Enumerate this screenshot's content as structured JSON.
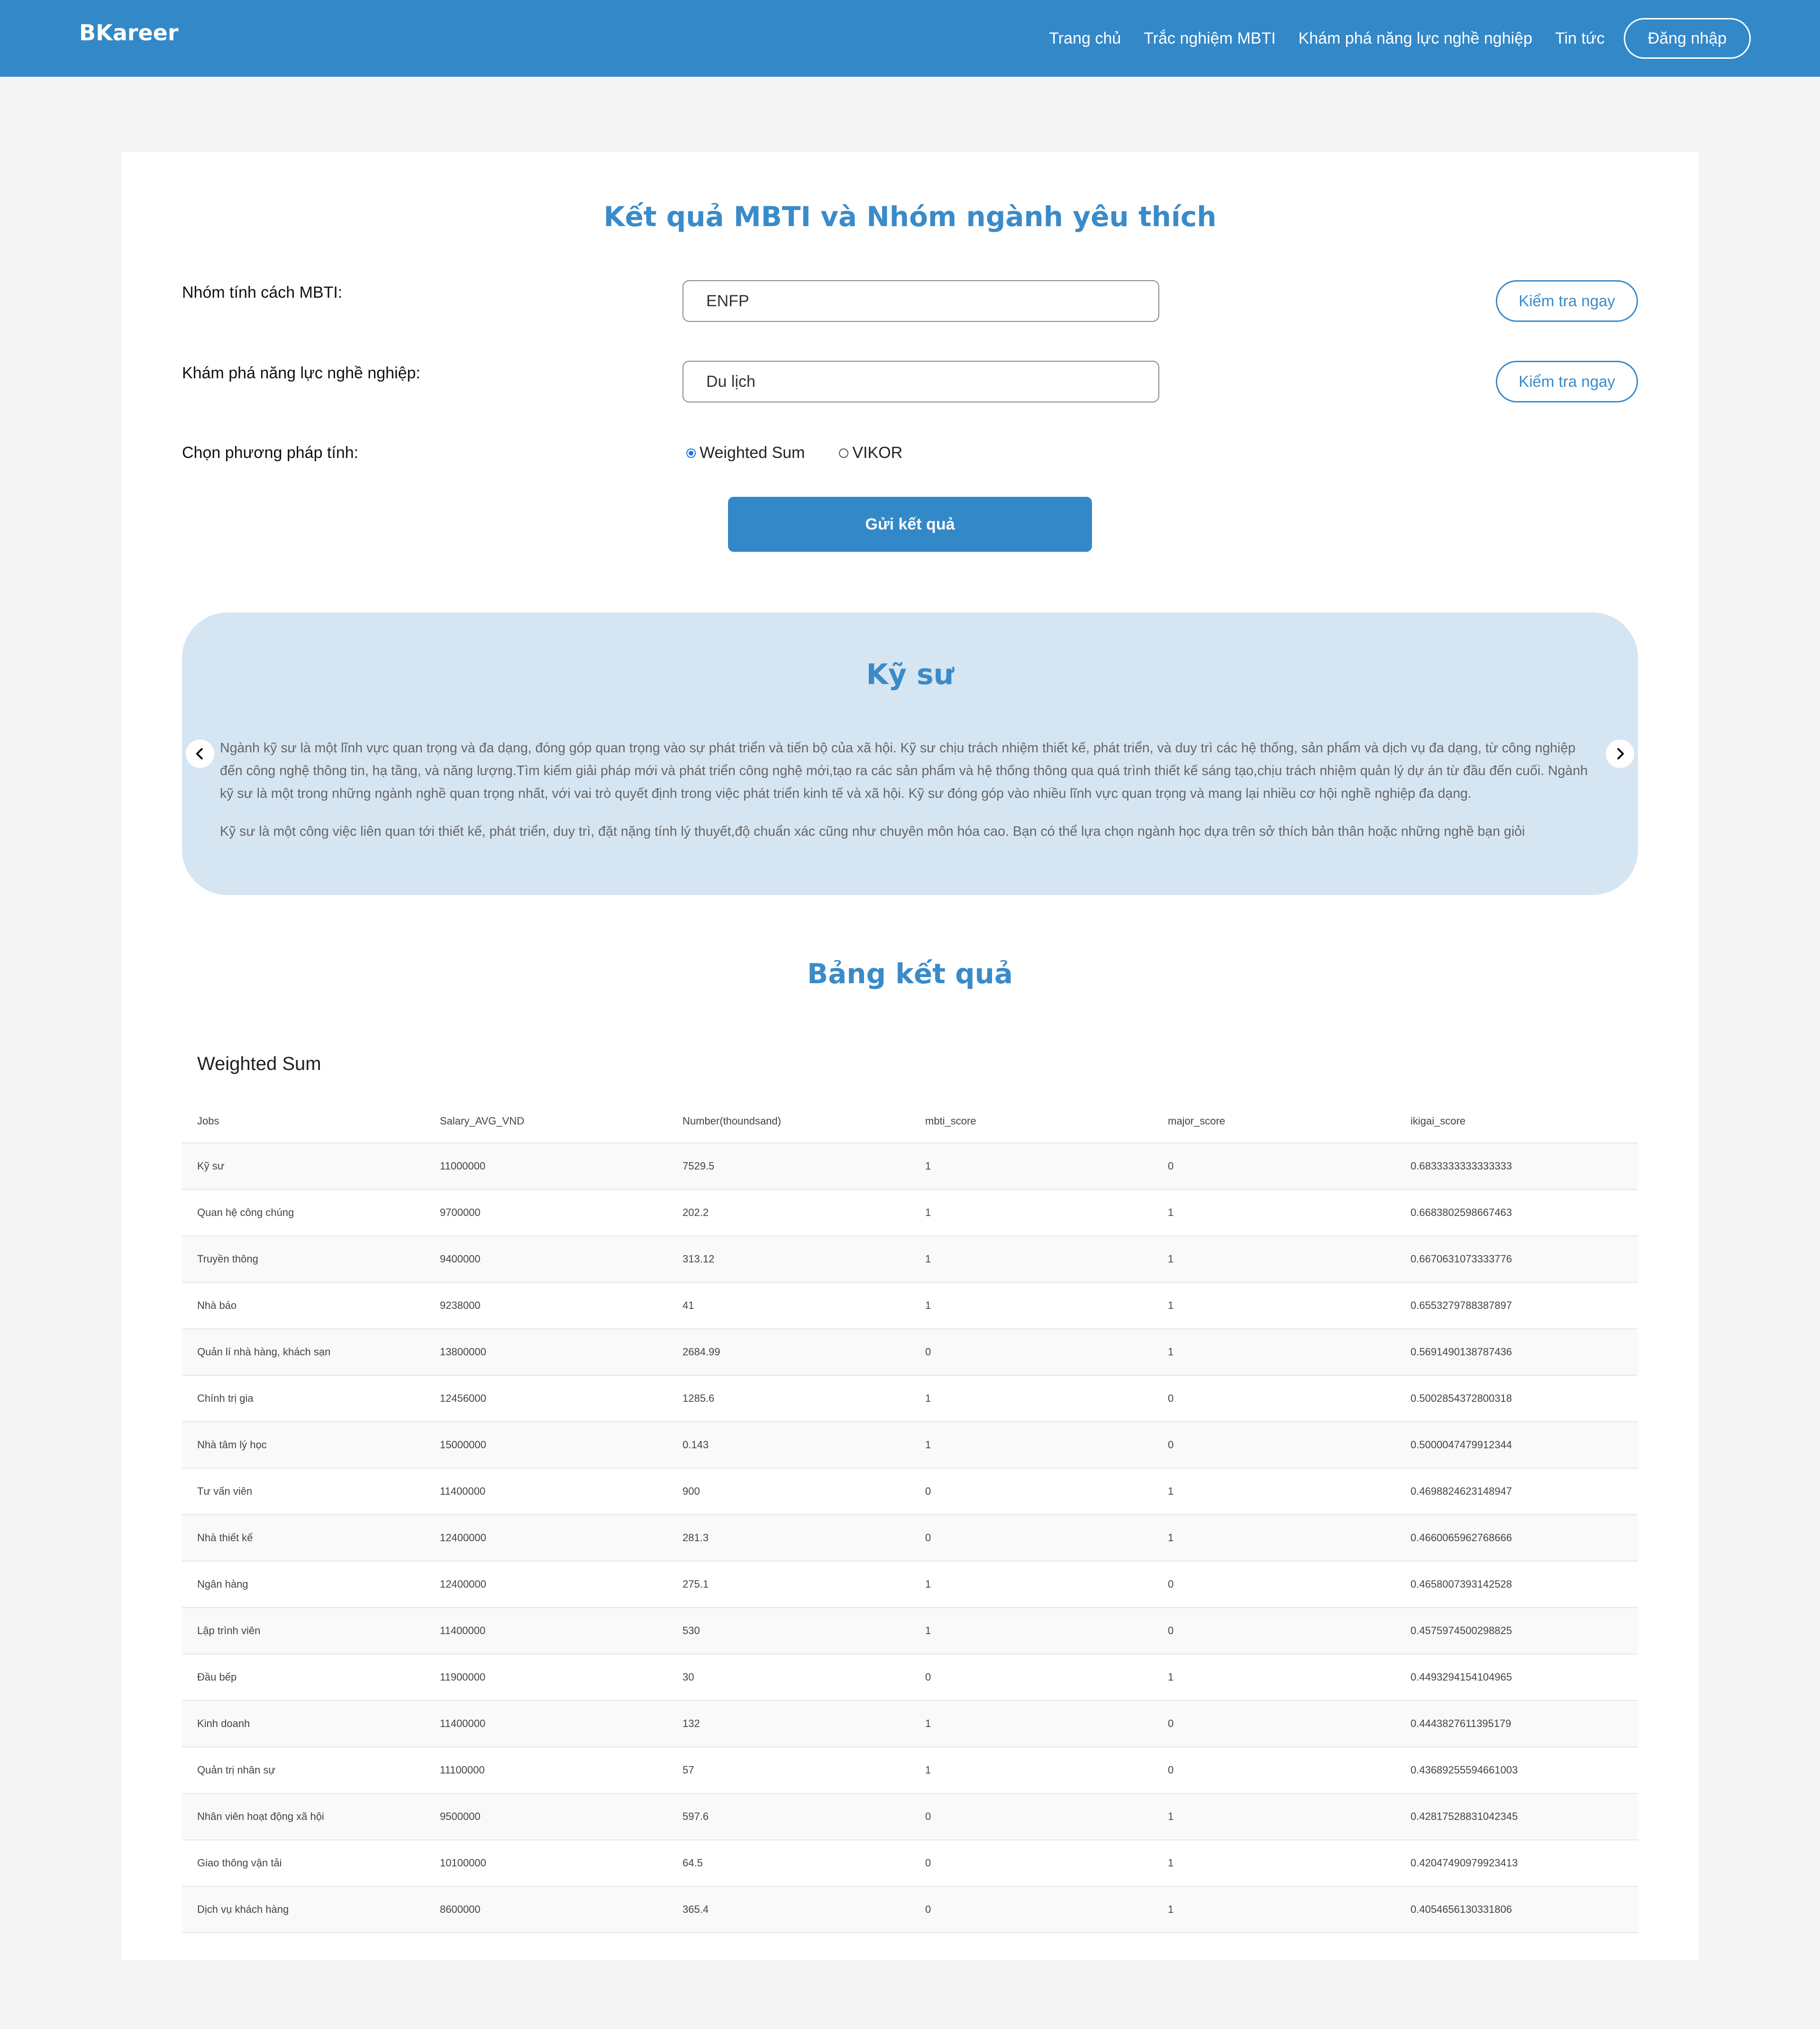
{
  "navbar": {
    "brand": "BKareer",
    "links": [
      "Trang chủ",
      "Trắc nghiệm MBTI",
      "Khám phá năng lực nghề nghiệp",
      "Tin tức"
    ],
    "login": "Đăng nhập"
  },
  "form": {
    "title": "Kết quả MBTI và Nhóm ngành yêu thích",
    "mbti_label": "Nhóm tính cách MBTI:",
    "mbti_value": "ENFP",
    "major_label": "Khám phá năng lực nghề nghiệp:",
    "major_value": "Du lịch",
    "check_label": "Kiểm tra ngay",
    "method_label": "Chọn phương pháp tính:",
    "methods": [
      "Weighted Sum",
      "VIKOR"
    ],
    "selected_method": "Weighted Sum",
    "submit_label": "Gửi kết quả"
  },
  "carousel": {
    "title": "Kỹ sư",
    "paragraph1": "Ngành kỹ sư là một lĩnh vực quan trọng và đa dạng, đóng góp quan trọng vào sự phát triển và tiến bộ của xã hội. Kỹ sư chịu trách nhiệm thiết kế, phát triển, và duy trì các hệ thống, sản phẩm và dịch vụ đa dạng, từ công nghiệp đến công nghệ thông tin, hạ tầng, và năng lượng.Tìm kiếm giải pháp mới và phát triển công nghệ mới,tạo ra các sản phẩm và hệ thống thông qua quá trình thiết kế sáng tạo,chịu trách nhiệm quản lý dự án từ đầu đến cuối. Ngành kỹ sư là một trong những ngành nghề quan trọng nhất, với vai trò quyết định trong việc phát triển kinh tế và xã hội. Kỹ sư đóng góp vào nhiều lĩnh vực quan trọng và mang lại nhiều cơ hội nghề nghiệp đa dạng.",
    "paragraph2": "Kỹ sư là một công việc liên quan tới thiết kế, phát triển, duy trì, đặt nặng tính lý thuyết,độ chuẩn xác cũng như chuyên môn hóa cao. Bạn có thể lựa chọn ngành học dựa trên sở thích bản thân hoặc những nghề bạn giỏi",
    "prev_icon": "chevron-left-icon",
    "next_icon": "chevron-right-icon"
  },
  "results": {
    "title": "Bảng kết quả",
    "caption": "Weighted Sum",
    "headers": [
      "Jobs",
      "Salary_AVG_VND",
      "Number(thoundsand)",
      "mbti_score",
      "major_score",
      "ikigai_score"
    ],
    "rows": [
      [
        "Kỹ sư",
        "11000000",
        "7529.5",
        "1",
        "0",
        "0.6833333333333333"
      ],
      [
        "Quan hệ công chúng",
        "9700000",
        "202.2",
        "1",
        "1",
        "0.6683802598667463"
      ],
      [
        "Truyền thông",
        "9400000",
        "313.12",
        "1",
        "1",
        "0.6670631073333776"
      ],
      [
        "Nhà báo",
        "9238000",
        "41",
        "1",
        "1",
        "0.6553279788387897"
      ],
      [
        "Quản lí nhà hàng, khách sạn",
        "13800000",
        "2684.99",
        "0",
        "1",
        "0.5691490138787436"
      ],
      [
        "Chính trị gia",
        "12456000",
        "1285.6",
        "1",
        "0",
        "0.5002854372800318"
      ],
      [
        "Nhà tâm lý học",
        "15000000",
        "0.143",
        "1",
        "0",
        "0.5000047479912344"
      ],
      [
        "Tư vấn viên",
        "11400000",
        "900",
        "0",
        "1",
        "0.4698824623148947"
      ],
      [
        "Nhà thiết kế",
        "12400000",
        "281.3",
        "0",
        "1",
        "0.4660065962768666"
      ],
      [
        "Ngân hàng",
        "12400000",
        "275.1",
        "1",
        "0",
        "0.4658007393142528"
      ],
      [
        "Lập trình viên",
        "11400000",
        "530",
        "1",
        "0",
        "0.4575974500298825"
      ],
      [
        "Đầu bếp",
        "11900000",
        "30",
        "0",
        "1",
        "0.4493294154104965"
      ],
      [
        "Kinh doanh",
        "11400000",
        "132",
        "1",
        "0",
        "0.4443827611395179"
      ],
      [
        "Quản trị nhân sự",
        "11100000",
        "57",
        "1",
        "0",
        "0.43689255594661003"
      ],
      [
        "Nhân viên hoạt động xã hội",
        "9500000",
        "597.6",
        "0",
        "1",
        "0.42817528831042345"
      ],
      [
        "Giao thông vận tải",
        "10100000",
        "64.5",
        "0",
        "1",
        "0.42047490979923413"
      ],
      [
        "Dịch vụ khách hàng",
        "8600000",
        "365.4",
        "0",
        "1",
        "0.4054656130331806"
      ]
    ]
  },
  "colors": {
    "primary": "#3388c8",
    "title": "#3a8bc9",
    "carousel_bg": "#d6e5f2",
    "page_bg": "#f4f4f4"
  }
}
